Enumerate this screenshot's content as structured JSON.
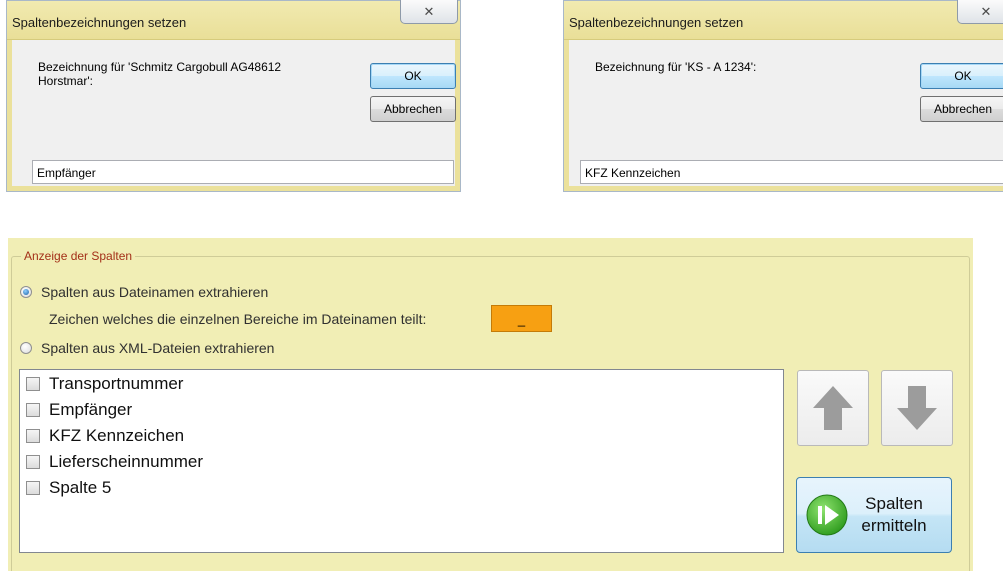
{
  "dialogs": [
    {
      "title": "Spaltenbezeichnungen setzen",
      "prompt": "Bezeichnung für 'Schmitz Cargobull AG48612 Horstmar':",
      "ok_label": "OK",
      "cancel_label": "Abbrechen",
      "value": "Empfänger"
    },
    {
      "title": "Spaltenbezeichnungen setzen",
      "prompt": "Bezeichnung für 'KS - A 1234':",
      "ok_label": "OK",
      "cancel_label": "Abbrechen",
      "value": "KFZ Kennzeichen"
    }
  ],
  "panel": {
    "legend": "Anzeige der Spalten",
    "radio_filename": "Spalten aus Dateinamen extrahieren",
    "separator_label": "Zeichen welches die einzelnen Bereiche im Dateinamen teilt:",
    "separator_value": "_",
    "radio_xml": "Spalten aus XML-Dateien extrahieren",
    "columns": [
      "Transportnummer",
      "Empfänger",
      "KFZ Kennzeichen",
      "Lieferscheinnummer",
      "Spalte 5"
    ],
    "determine_line1": "Spalten",
    "determine_line2": "ermitteln"
  },
  "colors": {
    "titlebar": "#ebe19b",
    "panel_bg": "#f1eeb5",
    "separator_box": "#f7a012",
    "legend_text": "#a33018",
    "play_green": "#3fae2a"
  },
  "icons": {
    "close": "close-icon",
    "up": "arrow-up-icon",
    "down": "arrow-down-icon",
    "play": "play-icon"
  }
}
